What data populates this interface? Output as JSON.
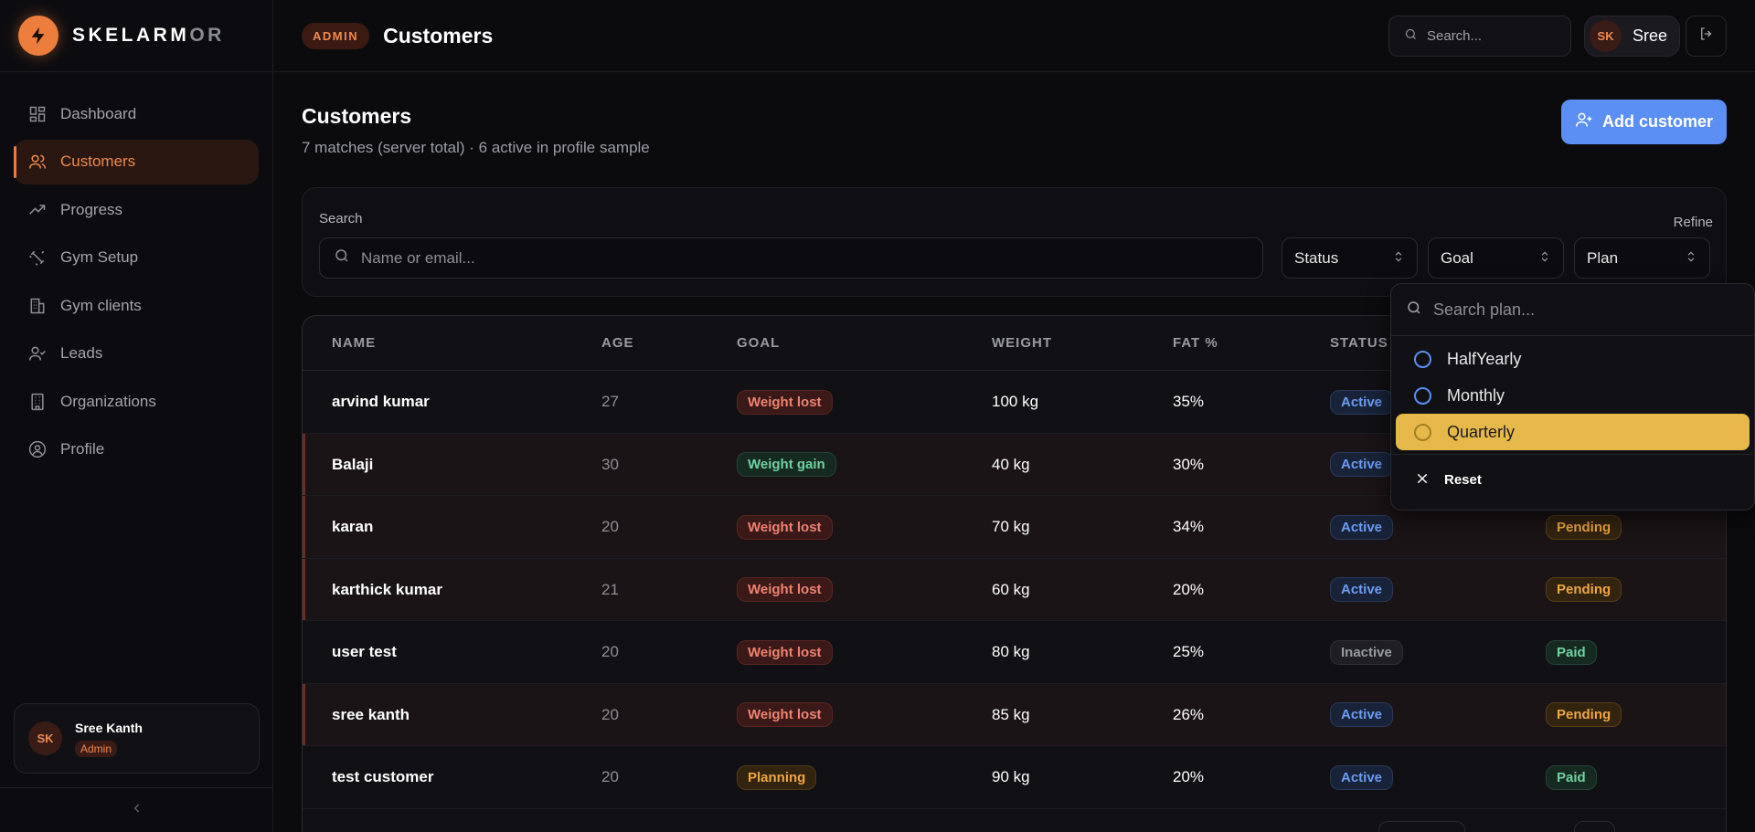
{
  "brand": {
    "name_bright": "SKELARM",
    "name_dim": "OR"
  },
  "sidebar": {
    "items": [
      {
        "label": "Dashboard",
        "icon": "dashboard-icon"
      },
      {
        "label": "Customers",
        "icon": "users-icon",
        "active": true
      },
      {
        "label": "Progress",
        "icon": "trending-up-icon"
      },
      {
        "label": "Gym Setup",
        "icon": "dumbbell-icon"
      },
      {
        "label": "Gym clients",
        "icon": "building-icon"
      },
      {
        "label": "Leads",
        "icon": "user-check-icon"
      },
      {
        "label": "Organizations",
        "icon": "office-icon"
      },
      {
        "label": "Profile",
        "icon": "profile-icon"
      }
    ],
    "user": {
      "initials": "SK",
      "name": "Sree Kanth",
      "role": "Admin"
    }
  },
  "topbar": {
    "badge": "ADMIN",
    "title": "Customers",
    "search_placeholder": "Search...",
    "user_initials": "SK",
    "user_name": "Sree"
  },
  "main": {
    "title": "Customers",
    "subtitle": "7 matches (server total) · 6 active in profile sample",
    "add_button": "Add customer"
  },
  "filters": {
    "search_label": "Search",
    "refine_label": "Refine",
    "search_placeholder": "Name or email...",
    "status": "Status",
    "goal": "Goal",
    "plan": "Plan"
  },
  "table": {
    "headers": [
      "NAME",
      "AGE",
      "GOAL",
      "WEIGHT",
      "FAT %",
      "STATUS"
    ],
    "rows": [
      {
        "name": "arvind kumar",
        "age": "27",
        "goal": "Weight lost",
        "weight": "100 kg",
        "fat": "35%",
        "status": "Active",
        "payment": "",
        "highlight": false
      },
      {
        "name": "Balaji",
        "age": "30",
        "goal": "Weight gain",
        "weight": "40 kg",
        "fat": "30%",
        "status": "Active",
        "payment": "",
        "highlight": true
      },
      {
        "name": "karan",
        "age": "20",
        "goal": "Weight lost",
        "weight": "70 kg",
        "fat": "34%",
        "status": "Active",
        "payment": "Pending",
        "highlight": true
      },
      {
        "name": "karthick kumar",
        "age": "21",
        "goal": "Weight lost",
        "weight": "60 kg",
        "fat": "20%",
        "status": "Active",
        "payment": "Pending",
        "highlight": true
      },
      {
        "name": "user test",
        "age": "20",
        "goal": "Weight lost",
        "weight": "80 kg",
        "fat": "25%",
        "status": "Inactive",
        "payment": "Paid",
        "highlight": false
      },
      {
        "name": "sree kanth",
        "age": "20",
        "goal": "Weight lost",
        "weight": "85 kg",
        "fat": "26%",
        "status": "Active",
        "payment": "Pending",
        "highlight": true
      },
      {
        "name": "test customer",
        "age": "20",
        "goal": "Planning",
        "weight": "90 kg",
        "fat": "20%",
        "status": "Active",
        "payment": "Paid",
        "highlight": false
      }
    ]
  },
  "plan_dropdown": {
    "search_placeholder": "Search plan...",
    "options": [
      "HalfYearly",
      "Monthly",
      "Quarterly"
    ],
    "selected": "Quarterly",
    "reset_label": "Reset"
  },
  "colors": {
    "accent": "#ee7b3a",
    "primary": "#5b8ff3",
    "selected_option": "#e6b84a"
  }
}
